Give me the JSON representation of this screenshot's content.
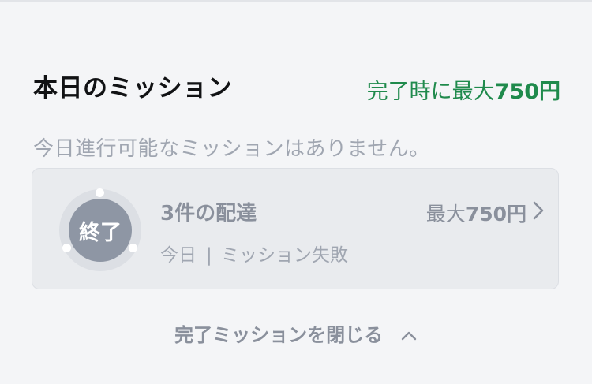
{
  "section": {
    "title": "本日のミッション",
    "reward_prefix": "完了時に最大",
    "reward_amount": "750円"
  },
  "empty_message": "今日進行可能なミッションはありません。",
  "mission": {
    "status_badge": "終了",
    "name": "3件の配達",
    "day": "今日",
    "separator": "|",
    "status_text": "ミッション失敗",
    "reward_prefix": "最大",
    "reward_amount": "750円"
  },
  "toggle": {
    "label": "完了ミッションを閉じる"
  },
  "colors": {
    "accent_green": "#1f8a4c",
    "muted_gray": "#8a909c",
    "badge_gray": "#8e96a4"
  },
  "icons": [
    "chevron-right-icon",
    "chevron-up-icon"
  ]
}
